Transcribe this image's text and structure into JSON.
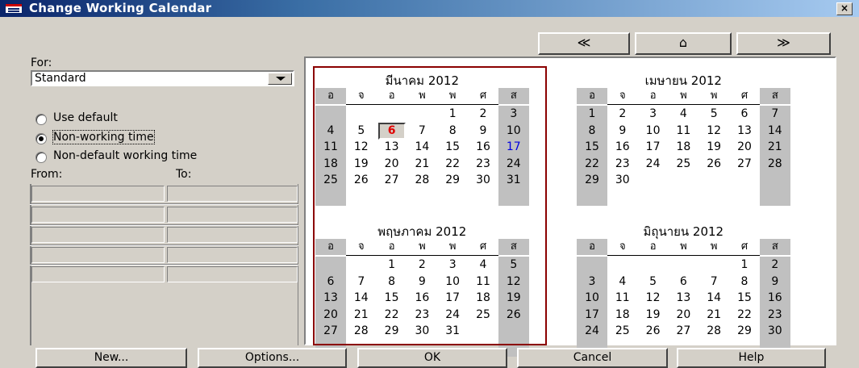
{
  "window": {
    "title": "Change Working Calendar",
    "close_label": "×"
  },
  "nav": {
    "prev": "≪",
    "today": "⌂",
    "next": "≫"
  },
  "left": {
    "for_label": "For:",
    "calendar_value": "Standard",
    "radio_use_default": "Use default",
    "radio_nonworking": "Non-working time",
    "radio_nondefault": "Non-default working time",
    "from_label": "From:",
    "to_label": "To:"
  },
  "calendar": {
    "day_headers": [
      "อ",
      "จ",
      "อ",
      "พ",
      "พ",
      "ศ",
      "ส"
    ],
    "months": [
      {
        "title": "มีนาคม 2012",
        "weeks": [
          [
            "",
            "",
            "",
            "",
            "1",
            "2",
            "3"
          ],
          [
            "4",
            "5",
            "6",
            "7",
            "8",
            "9",
            "10"
          ],
          [
            "11",
            "12",
            "13",
            "14",
            "15",
            "16",
            "17"
          ],
          [
            "18",
            "19",
            "20",
            "21",
            "22",
            "23",
            "24"
          ],
          [
            "25",
            "26",
            "27",
            "28",
            "29",
            "30",
            "31"
          ],
          [
            "",
            "",
            "",
            "",
            "",
            "",
            ""
          ]
        ]
      },
      {
        "title": "เมษายน 2012",
        "weeks": [
          [
            "1",
            "2",
            "3",
            "4",
            "5",
            "6",
            "7"
          ],
          [
            "8",
            "9",
            "10",
            "11",
            "12",
            "13",
            "14"
          ],
          [
            "15",
            "16",
            "17",
            "18",
            "19",
            "20",
            "21"
          ],
          [
            "22",
            "23",
            "24",
            "25",
            "26",
            "27",
            "28"
          ],
          [
            "29",
            "30",
            "",
            "",
            "",
            "",
            ""
          ],
          [
            "",
            "",
            "",
            "",
            "",
            "",
            ""
          ]
        ]
      },
      {
        "title": "พฤษภาคม 2012",
        "weeks": [
          [
            "",
            "",
            "1",
            "2",
            "3",
            "4",
            "5"
          ],
          [
            "6",
            "7",
            "8",
            "9",
            "10",
            "11",
            "12"
          ],
          [
            "13",
            "14",
            "15",
            "16",
            "17",
            "18",
            "19"
          ],
          [
            "20",
            "21",
            "22",
            "23",
            "24",
            "25",
            "26"
          ],
          [
            "27",
            "28",
            "29",
            "30",
            "31",
            "",
            ""
          ],
          [
            "",
            "",
            "",
            "",
            "",
            "",
            ""
          ]
        ]
      },
      {
        "title": "มิถุนายน 2012",
        "weeks": [
          [
            "",
            "",
            "",
            "",
            "",
            "1",
            "2"
          ],
          [
            "3",
            "4",
            "5",
            "6",
            "7",
            "8",
            "9"
          ],
          [
            "10",
            "11",
            "12",
            "13",
            "14",
            "15",
            "16"
          ],
          [
            "17",
            "18",
            "19",
            "20",
            "21",
            "22",
            "23"
          ],
          [
            "24",
            "25",
            "26",
            "27",
            "28",
            "29",
            "30"
          ],
          [
            "",
            "",
            "",
            "",
            "",
            "",
            ""
          ]
        ]
      }
    ],
    "today": {
      "month": 0,
      "day": "6"
    },
    "highlight": {
      "month": 0,
      "day": "17"
    }
  },
  "buttons": {
    "new": "New...",
    "options": "Options...",
    "ok": "OK",
    "cancel": "Cancel",
    "help": "Help"
  }
}
